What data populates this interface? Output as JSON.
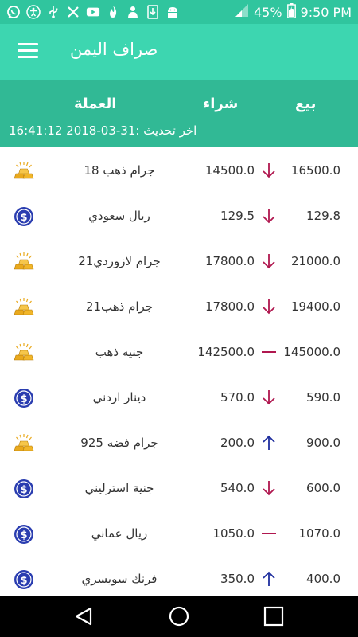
{
  "status_bar": {
    "battery": "45%",
    "time": "9:50 PM",
    "notification_icons": [
      "whatsapp-icon",
      "accessibility-icon",
      "usb-icon",
      "tools-icon",
      "youtube-icon",
      "flame-icon",
      "person-icon",
      "download-icon",
      "android-icon"
    ]
  },
  "app_bar": {
    "title": "صراف اليمن"
  },
  "table_header": {
    "sell_label": "بيع",
    "buy_label": "شراء",
    "currency_label": "العملة",
    "last_update": "اخر تحديث :31-03-2018 16:41:12"
  },
  "rates": [
    {
      "name": "جرام ذهب 18",
      "buy": "14500.0",
      "sell": "16500.0",
      "trend": "down",
      "icon": "gold-bars-icon"
    },
    {
      "name": "ريال سعودي",
      "buy": "129.5",
      "sell": "129.8",
      "trend": "down",
      "icon": "dollar-coin-icon"
    },
    {
      "name": "جرام لازوردي21",
      "buy": "17800.0",
      "sell": "21000.0",
      "trend": "down",
      "icon": "gold-bars-icon"
    },
    {
      "name": "جرام ذهب21",
      "buy": "17800.0",
      "sell": "19400.0",
      "trend": "down",
      "icon": "gold-bars-icon"
    },
    {
      "name": "جنيه ذهب",
      "buy": "142500.0",
      "sell": "145000.0",
      "trend": "flat",
      "icon": "gold-bars-icon"
    },
    {
      "name": "دينار اردني",
      "buy": "570.0",
      "sell": "590.0",
      "trend": "down",
      "icon": "dollar-coin-icon"
    },
    {
      "name": "جرام فضه 925",
      "buy": "200.0",
      "sell": "900.0",
      "trend": "up",
      "icon": "gold-bars-icon"
    },
    {
      "name": "جنية استرليني",
      "buy": "540.0",
      "sell": "600.0",
      "trend": "down",
      "icon": "dollar-coin-icon"
    },
    {
      "name": "ريال عماني",
      "buy": "1050.0",
      "sell": "1070.0",
      "trend": "flat",
      "icon": "dollar-coin-icon"
    },
    {
      "name": "فرنك سويسري",
      "buy": "350.0",
      "sell": "400.0",
      "trend": "up",
      "icon": "dollar-coin-icon"
    }
  ],
  "colors": {
    "status_bar": "#30c59e",
    "app_bar": "#3dd6b0",
    "header": "#31b995",
    "down": "#b0174f",
    "up": "#1f2f9e",
    "coin": "#2a3db0",
    "gold": "#e9a91d"
  },
  "nav_bar": {
    "icons": [
      "back-icon",
      "home-icon",
      "recents-icon"
    ]
  }
}
